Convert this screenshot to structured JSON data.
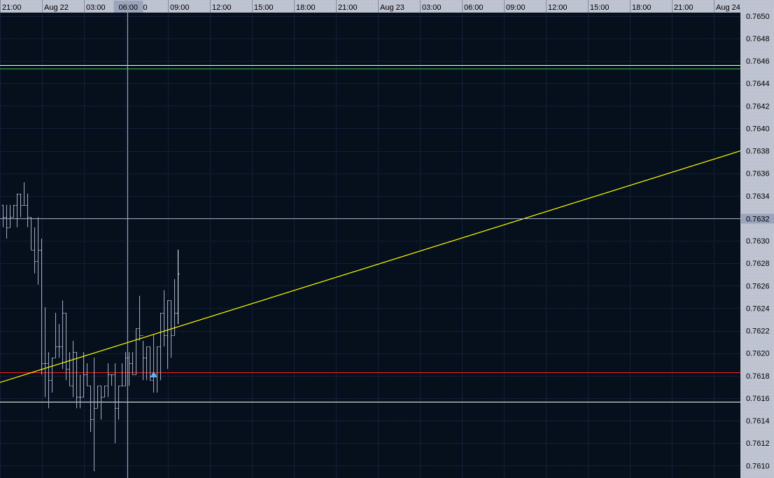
{
  "chart_data": {
    "type": "ohlc",
    "title": "",
    "xlabel": "",
    "ylabel": "",
    "bar_interval_minutes": 15,
    "first_bar_time": "Aug 21 21:00",
    "time_labels": [
      "21:00",
      "Aug 22",
      "03:00",
      "06:00",
      "09:00",
      "12:00",
      "15:00",
      "18:00",
      "21:00",
      "Aug 23",
      "03:00",
      "06:00",
      "09:00",
      "12:00",
      "15:00",
      "18:00",
      "21:00",
      "Aug 24"
    ],
    "price_labels": [
      "0.7610",
      "0.7612",
      "0.7614",
      "0.7616",
      "0.7618",
      "0.7620",
      "0.7622",
      "0.7624",
      "0.7626",
      "0.7628",
      "0.7630",
      "0.7632",
      "0.7634",
      "0.7636",
      "0.7638",
      "0.7640",
      "0.7642",
      "0.7644",
      "0.7646",
      "0.7648",
      "0.7650"
    ],
    "ylim": [
      0.76089,
      0.76503
    ],
    "grid": true,
    "bars": [
      [
        0.76332,
        0.76332,
        0.76312,
        0.76321
      ],
      [
        0.76321,
        0.76332,
        0.76302,
        0.76312
      ],
      [
        0.76312,
        0.76332,
        0.76312,
        0.76321
      ],
      [
        0.76321,
        0.76332,
        0.76321,
        0.76332
      ],
      [
        0.76332,
        0.76342,
        0.76312,
        0.76342
      ],
      [
        0.76342,
        0.76342,
        0.76321,
        0.76332
      ],
      [
        0.76332,
        0.76352,
        0.76332,
        0.76332
      ],
      [
        0.76332,
        0.76342,
        0.76312,
        0.76321
      ],
      [
        0.76321,
        0.76321,
        0.76292,
        0.76292
      ],
      [
        0.76292,
        0.76312,
        0.76271,
        0.76282
      ],
      [
        0.76282,
        0.76321,
        0.76261,
        0.76292
      ],
      [
        0.76292,
        0.76302,
        0.76181,
        0.76191
      ],
      [
        0.76191,
        0.76241,
        0.76161,
        0.76191
      ],
      [
        0.76191,
        0.76201,
        0.76151,
        0.76176
      ],
      [
        0.76176,
        0.76196,
        0.76165,
        0.76196
      ],
      [
        0.76196,
        0.76236,
        0.76196,
        0.76206
      ],
      [
        0.76206,
        0.76226,
        0.76196,
        0.76206
      ],
      [
        0.76206,
        0.76247,
        0.76186,
        0.76236
      ],
      [
        0.76236,
        0.76236,
        0.76176,
        0.76186
      ],
      [
        0.76186,
        0.76201,
        0.76171,
        0.76171
      ],
      [
        0.76171,
        0.76211,
        0.76161,
        0.76201
      ],
      [
        0.76201,
        0.76201,
        0.76151,
        0.76161
      ],
      [
        0.76161,
        0.76181,
        0.76151,
        0.76161
      ],
      [
        0.76161,
        0.76201,
        0.76161,
        0.76181
      ],
      [
        0.76181,
        0.76191,
        0.76171,
        0.76171
      ],
      [
        0.76171,
        0.76171,
        0.7613,
        0.76141
      ],
      [
        0.76141,
        0.76196,
        0.76095,
        0.76151
      ],
      [
        0.76151,
        0.76171,
        0.76151,
        0.76171
      ],
      [
        0.76171,
        0.76171,
        0.76141,
        0.76161
      ],
      [
        0.76161,
        0.76171,
        0.76161,
        0.76171
      ],
      [
        0.76171,
        0.76191,
        0.76161,
        0.76181
      ],
      [
        0.76181,
        0.76181,
        0.76171,
        0.76181
      ],
      [
        0.76181,
        0.76191,
        0.7612,
        0.76151
      ],
      [
        0.76151,
        0.76171,
        0.76141,
        0.76171
      ],
      [
        0.76171,
        0.76191,
        0.76171,
        0.76171
      ],
      [
        0.76171,
        0.76201,
        0.76171,
        0.76196
      ],
      [
        0.76196,
        0.76201,
        0.76171,
        0.76191
      ],
      [
        0.76191,
        0.76201,
        0.76181,
        0.76181
      ],
      [
        0.76181,
        0.76222,
        0.76181,
        0.76222
      ],
      [
        0.76222,
        0.76251,
        0.76211,
        0.76216
      ],
      [
        0.76216,
        0.76211,
        0.76176,
        0.76196
      ],
      [
        0.76196,
        0.76206,
        0.76176,
        0.76206
      ],
      [
        0.76206,
        0.76206,
        0.76176,
        0.76176
      ],
      [
        0.76176,
        0.76216,
        0.76165,
        0.76181
      ],
      [
        0.76181,
        0.76206,
        0.76165,
        0.76206
      ],
      [
        0.76206,
        0.76236,
        0.76176,
        0.76236
      ],
      [
        0.76236,
        0.76256,
        0.76206,
        0.76216
      ],
      [
        0.76216,
        0.76247,
        0.76186,
        0.76247
      ],
      [
        0.76247,
        0.76247,
        0.76196,
        0.76216
      ],
      [
        0.76216,
        0.76266,
        0.76216,
        0.76236
      ],
      [
        0.76236,
        0.76292,
        0.76226,
        0.76271
      ]
    ],
    "bar_fields": [
      "open",
      "high",
      "low",
      "close"
    ],
    "horizontal_lines": [
      {
        "name": "resistance-line",
        "price": 0.76456,
        "color": "#ffffff"
      },
      {
        "name": "green-level-line",
        "price": 0.76453,
        "color": "#40c040"
      },
      {
        "name": "crosshair-horizontal",
        "price": 0.7632,
        "color": "#a8b0c8"
      },
      {
        "name": "red-level-line",
        "price": 0.76183,
        "color": "#ff2020"
      },
      {
        "name": "support-line",
        "price": 0.76157,
        "color": "#ffffff"
      }
    ],
    "trendline": {
      "color": "#ffff00",
      "start": {
        "bar": -0.8,
        "price": 0.76174
      },
      "end": {
        "bar": 210.8,
        "price": 0.7638
      }
    },
    "crosshair": {
      "time_label": "06:00",
      "price_label": "0.7632",
      "bar": 35.6
    },
    "marker": {
      "type": "up-arrow",
      "bar": 43,
      "price": 0.76181,
      "color": "#60b0f0"
    }
  },
  "colors": {
    "background": "#06101c",
    "grid": "#1e2c50",
    "axis_bg": "#c4c8d4",
    "bar": "#a4acc4",
    "last_bar": "#e8ecf4",
    "highlight": "#9aa4bc"
  }
}
